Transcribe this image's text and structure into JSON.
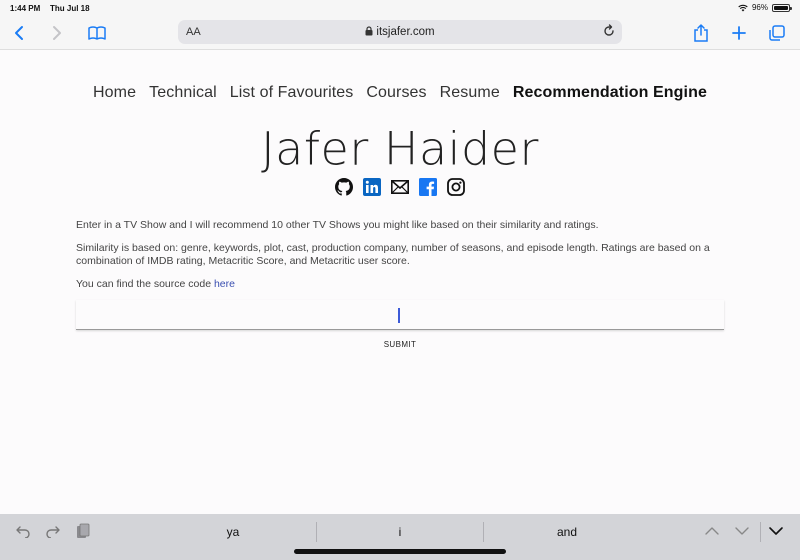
{
  "status_bar": {
    "time": "1:44 PM",
    "date": "Thu Jul 18",
    "battery": "96%"
  },
  "browser": {
    "text_size_label": "AA",
    "domain": "itsjafer.com"
  },
  "nav": {
    "items": [
      "Home",
      "Technical",
      "List of Favourites",
      "Courses",
      "Resume",
      "Recommendation Engine"
    ],
    "active": "Recommendation Engine"
  },
  "header": {
    "name": "Jafer Haider"
  },
  "socials": [
    "github-icon",
    "linkedin-icon",
    "email-icon",
    "facebook-icon",
    "instagram-icon"
  ],
  "content": {
    "intro": "Enter in a TV Show and I will recommend 10 other TV Shows you might like based on their similarity and ratings.",
    "similarity": "Similarity is based on: genre, keywords, plot, cast, production company, number of seasons, and episode length. Ratings are based on a combination of IMDB rating, Metacritic Score, and Metacritic user score.",
    "source_prefix": "You can find the source code ",
    "source_link": "here"
  },
  "form": {
    "input_value": "",
    "submit_label": "SUBMIT"
  },
  "keyboard_bar": {
    "suggestions": [
      "ya",
      "i",
      "and"
    ]
  },
  "colors": {
    "accent": "#3d5bd8",
    "link": "#3a4fb0",
    "ios_blue": "#1a7cf5",
    "linkedin": "#0a66c2",
    "facebook": "#1877f2"
  }
}
